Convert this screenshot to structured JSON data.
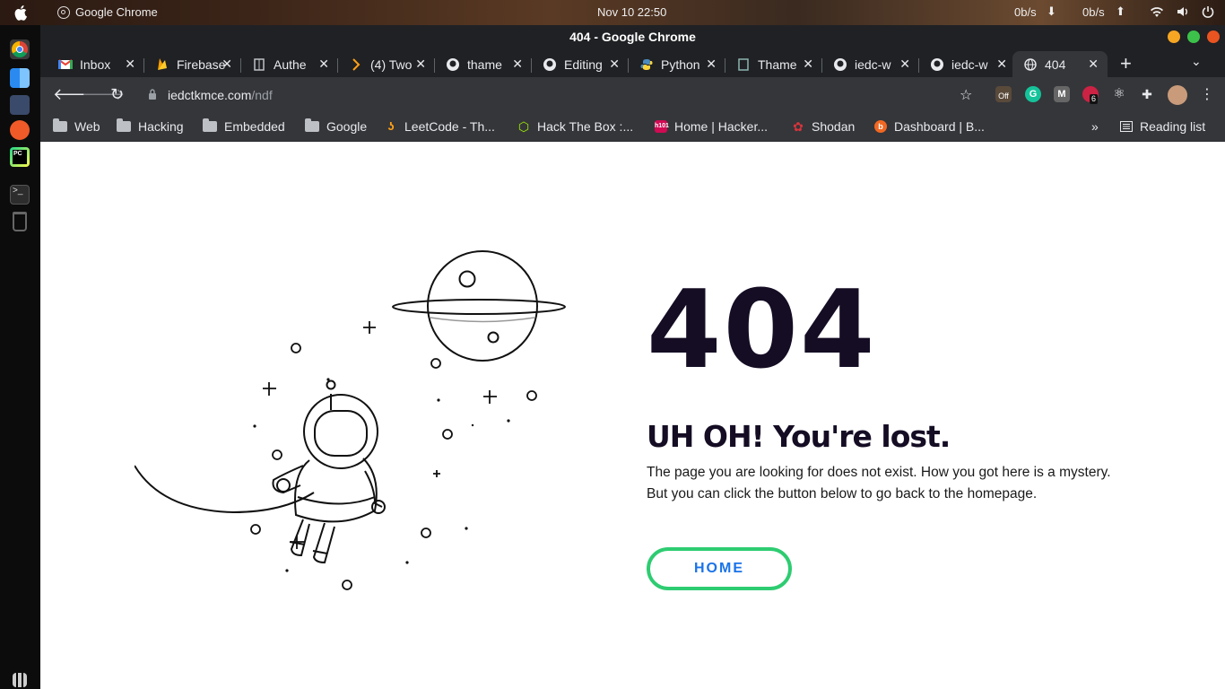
{
  "system_bar": {
    "app_name": "Google Chrome",
    "clock": "Nov 10  22:50",
    "net_down": "0b/s",
    "net_up": "0b/s"
  },
  "window": {
    "title": "404 - Google Chrome"
  },
  "tabs": [
    {
      "label": "Inbox",
      "icon": "gmail-icon"
    },
    {
      "label": "Firebase",
      "icon": "firebase-icon"
    },
    {
      "label": "Authe",
      "icon": "page-icon"
    },
    {
      "label": "(4) Two",
      "icon": "hackerrank-icon"
    },
    {
      "label": "thame",
      "icon": "github-icon"
    },
    {
      "label": "Editing",
      "icon": "github-icon"
    },
    {
      "label": "Python",
      "icon": "python-icon"
    },
    {
      "label": "Thame",
      "icon": "page-icon"
    },
    {
      "label": "iedc-w",
      "icon": "github-icon"
    },
    {
      "label": "iedc-w",
      "icon": "github-icon"
    },
    {
      "label": "404",
      "icon": "globe-icon",
      "active": true
    }
  ],
  "omnibox": {
    "host": "iedctkmce.com",
    "path": "/ndf"
  },
  "extensions": {
    "off_badge": "Off",
    "notification_count": "6"
  },
  "bookmarks": [
    {
      "label": "Web",
      "icon": "folder-icon"
    },
    {
      "label": "Hacking",
      "icon": "folder-icon"
    },
    {
      "label": "Embedded",
      "icon": "folder-icon"
    },
    {
      "label": "Google",
      "icon": "folder-icon"
    },
    {
      "label": "LeetCode - Th...",
      "icon": "leetcode-icon"
    },
    {
      "label": "Hack The Box :...",
      "icon": "hackthebox-icon"
    },
    {
      "label": "Home | Hacker...",
      "icon": "hacker101-icon"
    },
    {
      "label": "Shodan",
      "icon": "shodan-icon"
    },
    {
      "label": "Dashboard | B...",
      "icon": "bugcrowd-icon"
    }
  ],
  "reading_list": "Reading list",
  "page": {
    "code": "404",
    "heading": "UH OH! You're lost.",
    "line1": "The page you are looking for does not exist. How you got here is a mystery.",
    "line2": "But you can click the button below to go back to the homepage.",
    "button": "HOME"
  },
  "colors": {
    "heading": "#150d24",
    "button_border": "#2ecc71",
    "button_text": "#1a73e8",
    "chrome_dark": "#202124",
    "chrome_toolbar": "#35363a"
  }
}
